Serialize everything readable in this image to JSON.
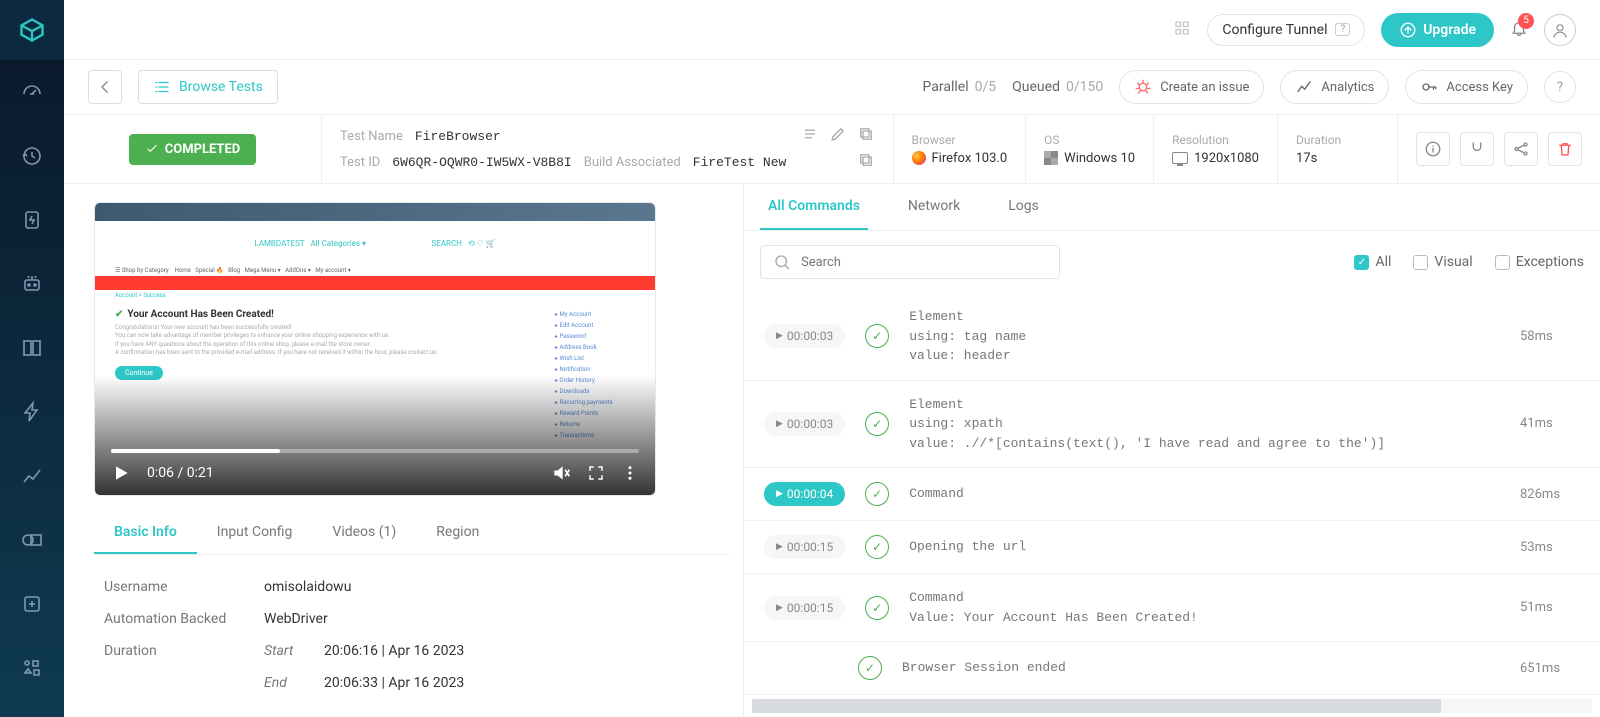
{
  "topbar": {
    "configure_tunnel": "Configure Tunnel",
    "upgrade": "Upgrade",
    "notification_count": "5"
  },
  "toolbar": {
    "browse_tests": "Browse Tests",
    "parallel_label": "Parallel",
    "parallel_value": "0/5",
    "queued_label": "Queued",
    "queued_value": "0/150",
    "create_issue": "Create an issue",
    "analytics": "Analytics",
    "access_key": "Access Key",
    "help": "?"
  },
  "status": {
    "label": "COMPLETED"
  },
  "test": {
    "name_label": "Test Name",
    "name_value": "FireBrowser",
    "id_label": "Test ID",
    "id_value": "6W6QR-OQWR0-IW5WX-V8B8I",
    "build_label": "Build Associated",
    "build_value": "FireTest New"
  },
  "meta": {
    "browser_label": "Browser",
    "browser_value": "Firefox 103.0",
    "os_label": "OS",
    "os_value": "Windows 10",
    "res_label": "Resolution",
    "res_value": "1920x1080",
    "dur_label": "Duration",
    "dur_value": "17s"
  },
  "video": {
    "time": "0:06 / 0:21",
    "title": "Your Account Has Been Created!",
    "body_lines": [
      "Congratulations! Your new account has been successfully created!",
      "You can now take advantage of member privileges to enhance your online shopping experience with us.",
      "If you have ANY questions about the operation of this online shop, please e-mail the store owner.",
      "A confirmation has been sent to the provided e-mail address. If you have not received it within the hour, please contact us."
    ],
    "btn": "Continue",
    "side_links": [
      "My Account",
      "Edit Account",
      "Password",
      "Address Book",
      "Wish List",
      "Notification",
      "Order History",
      "Downloads",
      "Recurring payments",
      "Reward Points",
      "Returns",
      "Transactions"
    ]
  },
  "info_tabs": [
    "Basic Info",
    "Input Config",
    "Videos (1)",
    "Region"
  ],
  "basic_info": {
    "username_k": "Username",
    "username_v": "omisolaidowu",
    "backed_k": "Automation Backed",
    "backed_v": "WebDriver",
    "duration_k": "Duration",
    "start_k": "Start",
    "start_v": "20:06:16 | Apr 16 2023",
    "end_k": "End",
    "end_v": "20:06:33 | Apr 16 2023"
  },
  "cmd_tabs": [
    "All Commands",
    "Network",
    "Logs"
  ],
  "search_placeholder": "Search",
  "filters": {
    "all": "All",
    "visual": "Visual",
    "exceptions": "Exceptions"
  },
  "commands": [
    {
      "ts": "00:00:03",
      "active": false,
      "text": "Element\nusing: tag name\nvalue: header",
      "dur": "58ms"
    },
    {
      "ts": "00:00:03",
      "active": false,
      "text": "Element\nusing: xpath\nvalue: .//*[contains(text(), 'I have read and agree to the')]",
      "dur": "41ms"
    },
    {
      "ts": "00:00:04",
      "active": true,
      "text": "Command",
      "dur": "826ms"
    },
    {
      "ts": "00:00:15",
      "active": false,
      "text": "Opening the url",
      "dur": "53ms"
    },
    {
      "ts": "00:00:15",
      "active": false,
      "text": "Command\nValue: Your Account Has Been Created!",
      "dur": "51ms"
    },
    {
      "ts": "",
      "active": false,
      "text": "Browser Session ended",
      "dur": "651ms"
    }
  ]
}
